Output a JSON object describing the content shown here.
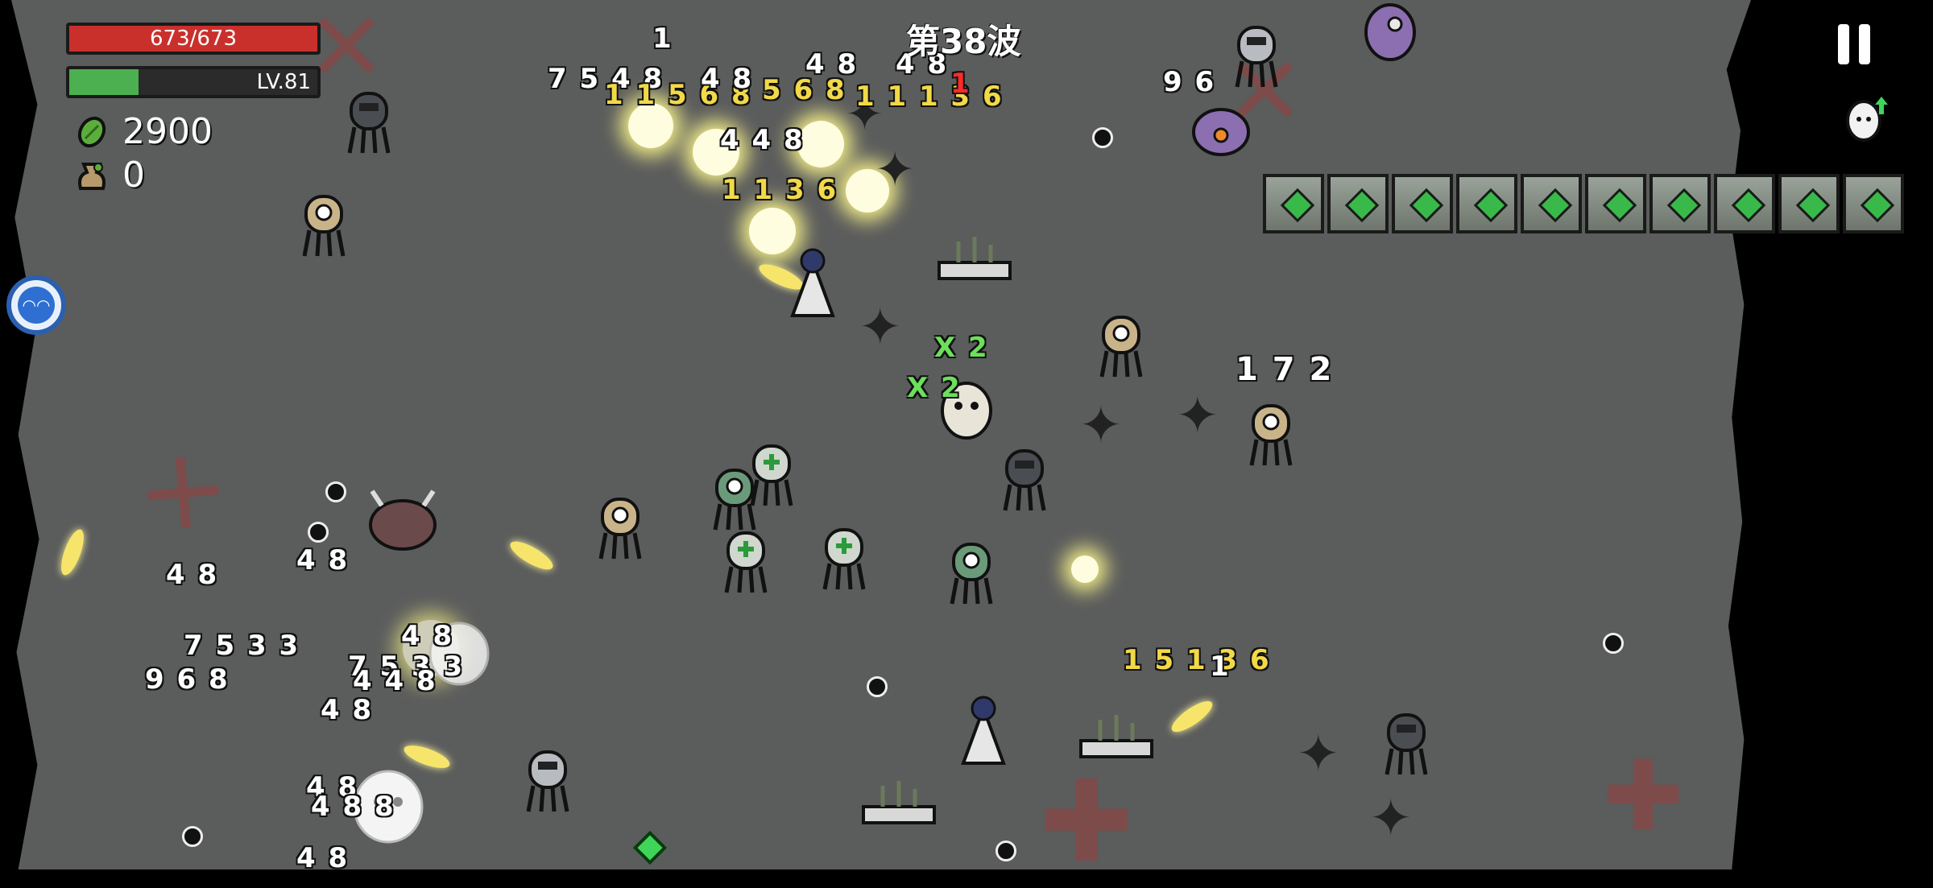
{
  "hud": {
    "hp_text": "673/673",
    "hp_fraction": 1.0,
    "level_text": "LV.81",
    "xp_fraction": 0.28,
    "materials": "2900",
    "bag": "0",
    "wave": "第38波"
  },
  "colors": {
    "arena": "#5b5c5c",
    "hp": "#c9302c",
    "xp": "#4caf50",
    "damage_white": "#ffffff",
    "damage_crit": "#f2d948",
    "heal": "#6ce05a"
  },
  "icons": {
    "materials": "green-seed-icon",
    "bag": "money-bag-icon",
    "pause": "pause-icon",
    "upgrade": "egg-upgrade-icon",
    "skill": "blue-skill-icon"
  },
  "damage_numbers": [
    {
      "text": "1",
      "kind": "w"
    },
    {
      "text": "7 5 4 8",
      "kind": "w"
    },
    {
      "text": "1 1 5 6 8",
      "kind": "y"
    },
    {
      "text": "4 8",
      "kind": "w"
    },
    {
      "text": "5 6 8",
      "kind": "y"
    },
    {
      "text": "4 8",
      "kind": "w"
    },
    {
      "text": "4 8",
      "kind": "w"
    },
    {
      "text": "1 1 1 3 6",
      "kind": "y"
    },
    {
      "text": "1",
      "kind": "r"
    },
    {
      "text": "9 6",
      "kind": "w"
    },
    {
      "text": "4 4 8",
      "kind": "w"
    },
    {
      "text": "1 1 3 6",
      "kind": "y"
    },
    {
      "text": "X 2",
      "kind": "g"
    },
    {
      "text": "X 2",
      "kind": "g"
    },
    {
      "text": "1 7 2",
      "kind": "w"
    },
    {
      "text": "4 8",
      "kind": "w"
    },
    {
      "text": "4 8",
      "kind": "w"
    },
    {
      "text": "7 5 3 3",
      "kind": "w"
    },
    {
      "text": "9 6 8",
      "kind": "w"
    },
    {
      "text": "4 8",
      "kind": "w"
    },
    {
      "text": "7 5 3 3",
      "kind": "w"
    },
    {
      "text": "4 4 8",
      "kind": "w"
    },
    {
      "text": "4 8",
      "kind": "w"
    },
    {
      "text": "4 8",
      "kind": "w"
    },
    {
      "text": "4 8 8",
      "kind": "w"
    },
    {
      "text": "4 8",
      "kind": "w"
    },
    {
      "text": "1 5 1 3 6",
      "kind": "y"
    },
    {
      "text": "1",
      "kind": "w"
    }
  ]
}
